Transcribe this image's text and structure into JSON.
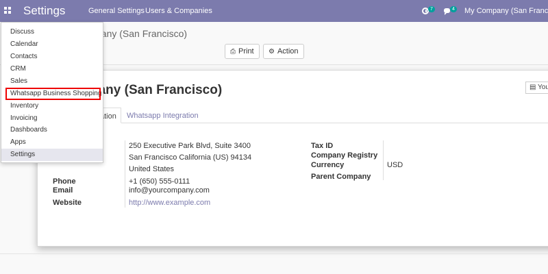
{
  "navbar": {
    "brand": "Settings",
    "menu": [
      "General Settings",
      "Users & Companies"
    ],
    "activity_count": "7",
    "messages_count": "4",
    "company": "My Company (San Francisco)"
  },
  "control_panel": {
    "title_partial": "pany (San Francisco)",
    "print_label": "Print",
    "action_label": "Action"
  },
  "sheet": {
    "title_partial": "pany (San Francisco)",
    "stat_button": "You",
    "tabs": [
      "ation",
      "Whatsapp Integration"
    ],
    "address": {
      "street": "250 Executive Park Blvd, Suite 3400",
      "city_line": "San Francisco  California (US)  94134",
      "country": "United States"
    },
    "left_fields": [
      {
        "label": "Phone",
        "value": "+1 (650) 555-0111"
      },
      {
        "label": "Email",
        "value": "info@yourcompany.com"
      },
      {
        "label": "Website",
        "value": "http://www.example.com"
      }
    ],
    "right_fields": [
      {
        "label": "Tax ID",
        "value": ""
      },
      {
        "label": "Company Registry",
        "value": ""
      },
      {
        "label": "Currency",
        "value": "USD"
      },
      {
        "label": "Parent Company",
        "value": ""
      }
    ]
  },
  "apps_menu": {
    "items": [
      "Discuss",
      "Calendar",
      "Contacts",
      "CRM",
      "Sales",
      "Whatsapp Business Shopping",
      "Inventory",
      "Invoicing",
      "Dashboards",
      "Apps",
      "Settings"
    ]
  }
}
